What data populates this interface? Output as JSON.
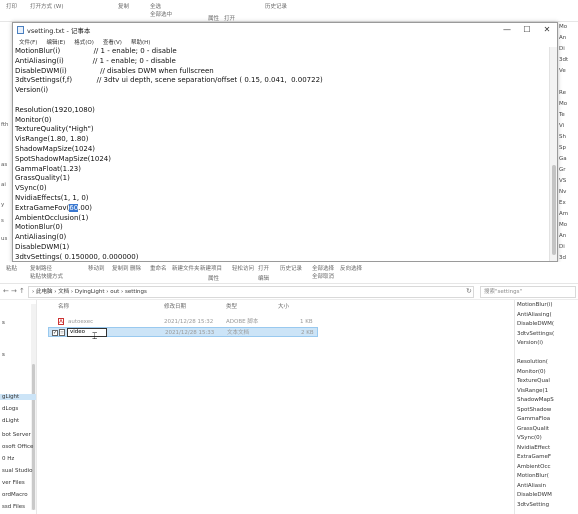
{
  "bg_top": {
    "labels": [
      "打印",
      "打开方式 (W)",
      "复制",
      "全选",
      "全部选中",
      "历史记录",
      "属性",
      "打开"
    ]
  },
  "notepad": {
    "title": "vsetting.txt - 记事本",
    "menu": [
      "文件(F)",
      "编辑(E)",
      "格式(O)",
      "查看(V)",
      "帮助(H)"
    ],
    "controls": [
      "—",
      "☐",
      "✕"
    ],
    "lines_before": [
      "MotionBlur(i)               // 1 - enable; 0 - disable",
      "AntiAliasing(i)             // 1 - enable; 0 - disable",
      "DisableDWM(i)               // disables DWM when fullscreen",
      "3dtvSettings(f,f)           // 3dtv ui depth, scene separation/offset ( 0.15, 0.041,  0.00722)",
      "Version(i)",
      "",
      "Resolution(1920,1080)",
      "Monitor(0)",
      "TextureQuality(\"High\")",
      "VisRange(1.80, 1.80)",
      "ShadowMapSize(1024)",
      "SpotShadowMapSize(1024)",
      "GammaFloat(1.23)",
      "GrassQuality(1)",
      "VSync(0)",
      "NvidiaEffects(1, 1, 0)"
    ],
    "fov_prefix": "ExtraGameFov(",
    "fov_selected": "60",
    "fov_suffix": ".00)",
    "lines_after": [
      "AmbientOcclusion(1)",
      "MotionBlur(0)",
      "AntiAliasing(0)",
      "DisableDWM(1)",
      "3dtvSettings( 0.150000, 0.000000)"
    ]
  },
  "right_col": [
    "Mo",
    "An",
    "Di",
    "3dt",
    "Ve",
    "",
    "Re",
    "Mo",
    "Te",
    "Vi",
    "Sh",
    "Sp",
    "Ga",
    "Gr",
    "VS",
    "Nv",
    "Ex",
    "Am",
    "Mo",
    "An",
    "Di",
    "3d"
  ],
  "left_gutter": [
    "fth",
    "as",
    "ai",
    "y",
    "s",
    "us"
  ],
  "ribbon2": {
    "labels": [
      "粘贴",
      "复制路径",
      "粘贴快捷方式",
      "移动到",
      "复制到",
      "删除",
      "重命名",
      "新建文件夹",
      "新建项目",
      "轻松访问",
      "属性",
      "打开",
      "编辑",
      "历史记录",
      "全部选择",
      "全部取消",
      "反向选择"
    ]
  },
  "address": {
    "path": "›  此电脑  ›  文档  ›  DyingLight  ›  out  ›  settings",
    "search_placeholder": "搜索\"settings\""
  },
  "navpane": {
    "items": [
      "s",
      "s",
      "gLight",
      "dLogs",
      "dLight",
      "bot Server",
      "osoft Office",
      "0 Hz",
      "sual Studio",
      "ver Files",
      "ordMacro",
      "ssd Files"
    ]
  },
  "filelist": {
    "headers": [
      "名称",
      "修改日期",
      "类型",
      "大小"
    ],
    "files": [
      {
        "name": "autoexec",
        "date": "2021/12/28 15:32",
        "type": "ADOBE 脚本",
        "size": "1 KB",
        "icon": "pdf-file-icon"
      },
      {
        "name": "video",
        "date": "2021/12/28 15:33",
        "type": "文本文档",
        "size": "2 KB",
        "icon": "text-file-icon"
      }
    ],
    "rename_value": "video"
  },
  "preview": {
    "lines": [
      "MotionBlur(i)",
      "AntiAliasing(",
      "DisableDWM(",
      "3dtvSettings(",
      "Version(i)",
      "",
      "Resolution(",
      "Monitor(0)",
      "TextureQual",
      "VisRange(1",
      "ShadowMapS",
      "SpotShadow",
      "GammaFloa",
      "GrassQualit",
      "VSync(0)",
      "NvidiaEffect",
      "ExtraGameF",
      "AmbientOcc",
      "MotionBlur(",
      "AntiAliasin",
      "DisableDWM",
      "3dtvSetting"
    ]
  },
  "colors": {
    "selection": "#3a78d0",
    "row_selected": "#cce4f7"
  }
}
